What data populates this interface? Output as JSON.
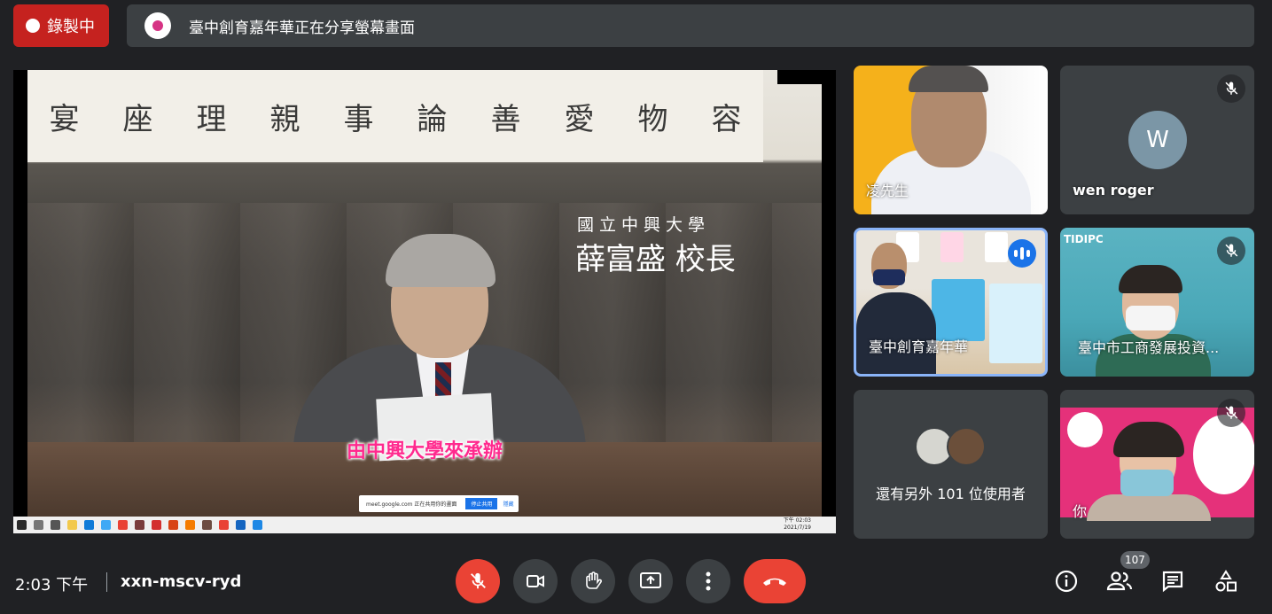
{
  "recording": {
    "label": "錄製中"
  },
  "share_banner": {
    "text": "臺中創育嘉年華正在分享螢幕畫面"
  },
  "presentation": {
    "calligraphy": [
      "宴",
      "座",
      "理",
      "親",
      "事",
      "論",
      "善",
      "愛",
      "物",
      "容"
    ],
    "speaker_org": "國立中興大學",
    "speaker_name": "薛富盛 校長",
    "subtitle": "由中興大學來承辦",
    "share_notice": "meet.google.com 正在共用你的畫面",
    "share_notice_stop": "停止共用",
    "share_notice_hide": "隱藏",
    "taskbar_time": "下午 02:03",
    "taskbar_date": "2021/7/19"
  },
  "participants": [
    {
      "name": "凌先生",
      "muted": false
    },
    {
      "name": "wen roger",
      "avatar_letter": "W",
      "muted": true
    },
    {
      "name": "臺中創育嘉年華",
      "speaking": true
    },
    {
      "name": "臺中市工商發展投資...",
      "logo_text": "TIDIPC",
      "muted": true
    },
    {
      "name": "你",
      "muted": true
    }
  ],
  "more_participants": {
    "text": "還有另外 101 位使用者"
  },
  "bottom_bar": {
    "time": "2:03 下午",
    "meeting_code": "xxn-mscv-ryd",
    "people_count": "107"
  },
  "colors": {
    "background": "#202124",
    "tile": "#3c4043",
    "record_red": "#c5221f",
    "danger": "#ea4335",
    "active_border": "#8ab4f8",
    "speaking_blue": "#1a73e8",
    "subtitle_pink": "#ff2a8e"
  },
  "icons": [
    "record-dot-icon",
    "mic-off-icon",
    "camera-icon",
    "raise-hand-icon",
    "present-icon",
    "more-options-icon",
    "hangup-icon",
    "info-icon",
    "people-icon",
    "chat-icon",
    "activities-icon"
  ]
}
